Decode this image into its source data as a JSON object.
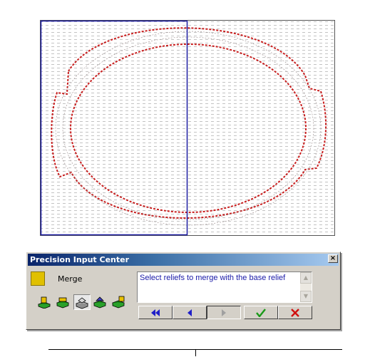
{
  "window": {
    "title": "Precision Input Center",
    "close_label": "×"
  },
  "panel": {
    "merge_label": "Merge",
    "swatch_color": "#e0c000",
    "message": "Select reliefs to merge with the base relief",
    "tools": [
      "add-relief-icon",
      "subtract-relief-icon",
      "merge-relief-icon",
      "replace-relief-icon",
      "zero-relief-icon"
    ],
    "active_tool_index": 2,
    "nav": [
      "first-icon",
      "back-icon",
      "forward-icon",
      "accept-icon",
      "cancel-icon"
    ]
  },
  "colors": {
    "accent_blue": "#0a246a",
    "contour_red": "#c81e1e",
    "selection_outline": "#1c1ca0"
  }
}
